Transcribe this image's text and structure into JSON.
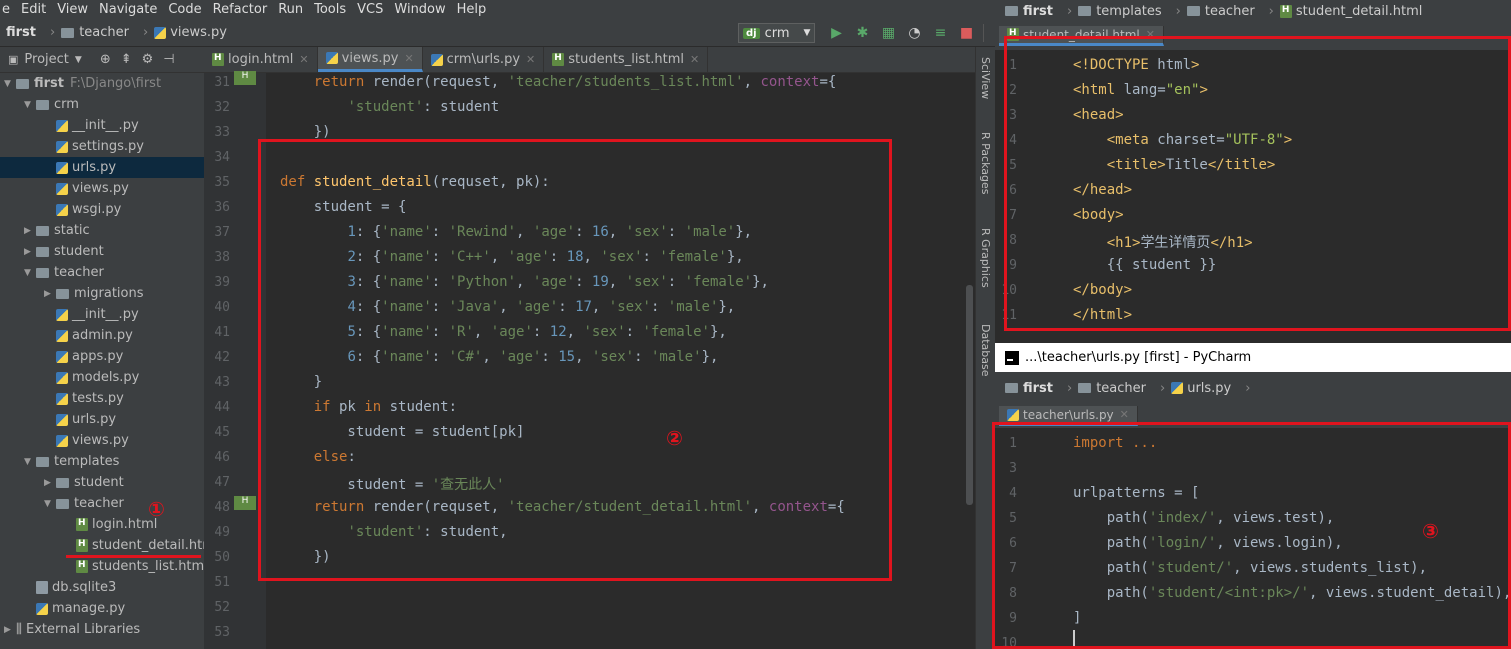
{
  "menu": [
    "e",
    "Edit",
    "View",
    "Navigate",
    "Code",
    "Refactor",
    "Run",
    "Tools",
    "VCS",
    "Window",
    "Help"
  ],
  "breadcrumb": {
    "project": "first",
    "folder": "teacher",
    "file": "views.py"
  },
  "run_config": {
    "badge": "dj",
    "name": "crm"
  },
  "project_panel": {
    "label": "Project"
  },
  "tree": [
    {
      "label": "first",
      "extra": "F:\\Django\\first",
      "type": "folder",
      "depth": 0,
      "open": true
    },
    {
      "label": "crm",
      "type": "folder",
      "depth": 1,
      "open": true
    },
    {
      "label": "__init__.py",
      "type": "py",
      "depth": 2
    },
    {
      "label": "settings.py",
      "type": "py",
      "depth": 2
    },
    {
      "label": "urls.py",
      "type": "py",
      "depth": 2,
      "selected": true
    },
    {
      "label": "views.py",
      "type": "py",
      "depth": 2
    },
    {
      "label": "wsgi.py",
      "type": "py",
      "depth": 2
    },
    {
      "label": "static",
      "type": "folder",
      "depth": 1,
      "open": false
    },
    {
      "label": "student",
      "type": "folder",
      "depth": 1,
      "open": false
    },
    {
      "label": "teacher",
      "type": "folder",
      "depth": 1,
      "open": true
    },
    {
      "label": "migrations",
      "type": "folder",
      "depth": 2,
      "open": false
    },
    {
      "label": "__init__.py",
      "type": "py",
      "depth": 2
    },
    {
      "label": "admin.py",
      "type": "py",
      "depth": 2
    },
    {
      "label": "apps.py",
      "type": "py",
      "depth": 2
    },
    {
      "label": "models.py",
      "type": "py",
      "depth": 2
    },
    {
      "label": "tests.py",
      "type": "py",
      "depth": 2
    },
    {
      "label": "urls.py",
      "type": "py",
      "depth": 2
    },
    {
      "label": "views.py",
      "type": "py",
      "depth": 2
    },
    {
      "label": "templates",
      "type": "folder",
      "depth": 1,
      "open": true
    },
    {
      "label": "student",
      "type": "folder",
      "depth": 2,
      "open": false
    },
    {
      "label": "teacher",
      "type": "folder",
      "depth": 2,
      "open": true
    },
    {
      "label": "login.html",
      "type": "html",
      "depth": 3
    },
    {
      "label": "student_detail.html",
      "type": "html",
      "depth": 3
    },
    {
      "label": "students_list.html",
      "type": "html",
      "depth": 3
    },
    {
      "label": "db.sqlite3",
      "type": "file",
      "depth": 1
    },
    {
      "label": "manage.py",
      "type": "py",
      "depth": 1
    },
    {
      "label": "External Libraries",
      "type": "lib",
      "depth": 0,
      "open": false
    }
  ],
  "tabs": [
    {
      "label": "login.html",
      "type": "html"
    },
    {
      "label": "views.py",
      "type": "py",
      "active": true
    },
    {
      "label": "crm\\urls.py",
      "type": "py"
    },
    {
      "label": "students_list.html",
      "type": "html"
    }
  ],
  "editor_lines": [
    {
      "n": "31",
      "t": [
        [
          "    ",
          ""
        ],
        [
          "return",
          "kw"
        ],
        [
          " render(request, ",
          ""
        ],
        [
          "'teacher/students_list.html'",
          "st"
        ],
        [
          ", ",
          ""
        ],
        [
          "context",
          "pm"
        ],
        [
          "={",
          ""
        ]
      ]
    },
    {
      "n": "32",
      "t": [
        [
          "        ",
          ""
        ],
        [
          "'student'",
          "st"
        ],
        [
          ": student",
          ""
        ]
      ]
    },
    {
      "n": "33",
      "t": [
        [
          "    })",
          ""
        ]
      ]
    },
    {
      "n": "34",
      "t": []
    },
    {
      "n": "35",
      "t": [
        [
          "def ",
          "kw"
        ],
        [
          "student_detail",
          "fn"
        ],
        [
          "(requset, pk):",
          ""
        ]
      ]
    },
    {
      "n": "36",
      "t": [
        [
          "    student = {",
          ""
        ]
      ]
    },
    {
      "n": "37",
      "t": [
        [
          "        ",
          ""
        ],
        [
          "1",
          "nm"
        ],
        [
          ": {",
          ""
        ],
        [
          "'name'",
          "st"
        ],
        [
          ": ",
          ""
        ],
        [
          "'Rewind'",
          "st"
        ],
        [
          ", ",
          ""
        ],
        [
          "'age'",
          "st"
        ],
        [
          ": ",
          ""
        ],
        [
          "16",
          "nm"
        ],
        [
          ", ",
          ""
        ],
        [
          "'sex'",
          "st"
        ],
        [
          ": ",
          ""
        ],
        [
          "'male'",
          "st"
        ],
        [
          "},",
          ""
        ]
      ]
    },
    {
      "n": "38",
      "t": [
        [
          "        ",
          ""
        ],
        [
          "2",
          "nm"
        ],
        [
          ": {",
          ""
        ],
        [
          "'name'",
          "st"
        ],
        [
          ": ",
          ""
        ],
        [
          "'C++'",
          "st"
        ],
        [
          ", ",
          ""
        ],
        [
          "'age'",
          "st"
        ],
        [
          ": ",
          ""
        ],
        [
          "18",
          "nm"
        ],
        [
          ", ",
          ""
        ],
        [
          "'sex'",
          "st"
        ],
        [
          ": ",
          ""
        ],
        [
          "'female'",
          "st"
        ],
        [
          "},",
          ""
        ]
      ]
    },
    {
      "n": "39",
      "t": [
        [
          "        ",
          ""
        ],
        [
          "3",
          "nm"
        ],
        [
          ": {",
          ""
        ],
        [
          "'name'",
          "st"
        ],
        [
          ": ",
          ""
        ],
        [
          "'Python'",
          "st"
        ],
        [
          ", ",
          ""
        ],
        [
          "'age'",
          "st"
        ],
        [
          ": ",
          ""
        ],
        [
          "19",
          "nm"
        ],
        [
          ", ",
          ""
        ],
        [
          "'sex'",
          "st"
        ],
        [
          ": ",
          ""
        ],
        [
          "'female'",
          "st"
        ],
        [
          "},",
          ""
        ]
      ]
    },
    {
      "n": "40",
      "t": [
        [
          "        ",
          ""
        ],
        [
          "4",
          "nm"
        ],
        [
          ": {",
          ""
        ],
        [
          "'name'",
          "st"
        ],
        [
          ": ",
          ""
        ],
        [
          "'Java'",
          "st"
        ],
        [
          ", ",
          ""
        ],
        [
          "'age'",
          "st"
        ],
        [
          ": ",
          ""
        ],
        [
          "17",
          "nm"
        ],
        [
          ", ",
          ""
        ],
        [
          "'sex'",
          "st"
        ],
        [
          ": ",
          ""
        ],
        [
          "'male'",
          "st"
        ],
        [
          "},",
          ""
        ]
      ]
    },
    {
      "n": "41",
      "t": [
        [
          "        ",
          ""
        ],
        [
          "5",
          "nm"
        ],
        [
          ": {",
          ""
        ],
        [
          "'name'",
          "st"
        ],
        [
          ": ",
          ""
        ],
        [
          "'R'",
          "st"
        ],
        [
          ", ",
          ""
        ],
        [
          "'age'",
          "st"
        ],
        [
          ": ",
          ""
        ],
        [
          "12",
          "nm"
        ],
        [
          ", ",
          ""
        ],
        [
          "'sex'",
          "st"
        ],
        [
          ": ",
          ""
        ],
        [
          "'female'",
          "st"
        ],
        [
          "},",
          ""
        ]
      ]
    },
    {
      "n": "42",
      "t": [
        [
          "        ",
          ""
        ],
        [
          "6",
          "nm"
        ],
        [
          ": {",
          ""
        ],
        [
          "'name'",
          "st"
        ],
        [
          ": ",
          ""
        ],
        [
          "'C#'",
          "st"
        ],
        [
          ", ",
          ""
        ],
        [
          "'age'",
          "st"
        ],
        [
          ": ",
          ""
        ],
        [
          "15",
          "nm"
        ],
        [
          ", ",
          ""
        ],
        [
          "'sex'",
          "st"
        ],
        [
          ": ",
          ""
        ],
        [
          "'male'",
          "st"
        ],
        [
          "},",
          ""
        ]
      ]
    },
    {
      "n": "43",
      "t": [
        [
          "    }",
          ""
        ]
      ]
    },
    {
      "n": "44",
      "t": [
        [
          "    ",
          ""
        ],
        [
          "if",
          "kw"
        ],
        [
          " pk ",
          ""
        ],
        [
          "in",
          "kw"
        ],
        [
          " student:",
          ""
        ]
      ]
    },
    {
      "n": "45",
      "t": [
        [
          "        student = student[pk]",
          ""
        ]
      ]
    },
    {
      "n": "46",
      "t": [
        [
          "    ",
          ""
        ],
        [
          "else",
          "kw"
        ],
        [
          ":",
          ""
        ]
      ]
    },
    {
      "n": "47",
      "t": [
        [
          "        student = ",
          ""
        ],
        [
          "'查无此人'",
          "st"
        ]
      ]
    },
    {
      "n": "48",
      "t": [
        [
          "    ",
          ""
        ],
        [
          "return",
          "kw"
        ],
        [
          " render(requset, ",
          ""
        ],
        [
          "'teacher/student_detail.html'",
          "st"
        ],
        [
          ", ",
          ""
        ],
        [
          "context",
          "pm"
        ],
        [
          "={",
          ""
        ]
      ]
    },
    {
      "n": "49",
      "t": [
        [
          "        ",
          ""
        ],
        [
          "'student'",
          "st"
        ],
        [
          ": student,",
          ""
        ]
      ]
    },
    {
      "n": "50",
      "t": [
        [
          "    })",
          ""
        ]
      ]
    },
    {
      "n": "51",
      "t": []
    },
    {
      "n": "52",
      "t": []
    },
    {
      "n": "53",
      "t": []
    }
  ],
  "side_tools": [
    "SciView",
    "R Packages",
    "R Graphics",
    "Database"
  ],
  "annotations": [
    "①",
    "②",
    "③"
  ],
  "right_top": {
    "breadcrumb": {
      "project": "first",
      "folder": "templates",
      "folder2": "teacher",
      "file": "student_detail.html"
    },
    "tab": "student_detail.html",
    "lines": [
      {
        "n": "1",
        "t": [
          [
            "<!DOCTYPE ",
            "tg"
          ],
          [
            "html",
            ""
          ],
          [
            ">",
            "tg"
          ]
        ]
      },
      {
        "n": "2",
        "t": [
          [
            "<html ",
            "tg"
          ],
          [
            "lang=",
            ""
          ],
          [
            "\"en\"",
            "av"
          ],
          [
            ">",
            "tg"
          ]
        ]
      },
      {
        "n": "3",
        "t": [
          [
            "<head>",
            "tg"
          ]
        ]
      },
      {
        "n": "4",
        "t": [
          [
            "    <meta ",
            "tg"
          ],
          [
            "charset=",
            ""
          ],
          [
            "\"UTF-8\"",
            "av"
          ],
          [
            ">",
            "tg"
          ]
        ]
      },
      {
        "n": "5",
        "t": [
          [
            "    <title>",
            "tg"
          ],
          [
            "Title",
            ""
          ],
          [
            "</title>",
            "tg"
          ]
        ]
      },
      {
        "n": "6",
        "t": [
          [
            "</head>",
            "tg"
          ]
        ]
      },
      {
        "n": "7",
        "t": [
          [
            "<body>",
            "tg"
          ]
        ]
      },
      {
        "n": "8",
        "t": [
          [
            "    <h1>",
            "tg"
          ],
          [
            "学生详情页",
            ""
          ],
          [
            "</h1>",
            "tg"
          ]
        ]
      },
      {
        "n": "9",
        "t": [
          [
            "    {{ student }}",
            ""
          ]
        ]
      },
      {
        "n": "10",
        "t": [
          [
            "</body>",
            "tg"
          ]
        ]
      },
      {
        "n": "11",
        "t": [
          [
            "</html>",
            "tg"
          ]
        ]
      }
    ]
  },
  "pycharm_title": "...\\teacher\\urls.py [first] - PyCharm",
  "right_bottom": {
    "breadcrumb": {
      "project": "first",
      "folder": "teacher",
      "file": "urls.py"
    },
    "tab": "teacher\\urls.py",
    "lines": [
      {
        "n": "1",
        "t": [
          [
            "import ...",
            "kw"
          ]
        ]
      },
      {
        "n": "3",
        "t": []
      },
      {
        "n": "4",
        "t": [
          [
            "urlpatterns = [",
            ""
          ]
        ]
      },
      {
        "n": "5",
        "t": [
          [
            "    path(",
            ""
          ],
          [
            "'index/'",
            "st"
          ],
          [
            ", views.test),",
            ""
          ]
        ]
      },
      {
        "n": "6",
        "t": [
          [
            "    path(",
            ""
          ],
          [
            "'login/'",
            "st"
          ],
          [
            ", views.login),",
            ""
          ]
        ]
      },
      {
        "n": "7",
        "t": [
          [
            "    path(",
            ""
          ],
          [
            "'student/'",
            "st"
          ],
          [
            ", views.students_list),",
            ""
          ]
        ]
      },
      {
        "n": "8",
        "t": [
          [
            "    path(",
            ""
          ],
          [
            "'student/<int:pk>/'",
            "st"
          ],
          [
            ", views.student_detail),",
            ""
          ]
        ]
      },
      {
        "n": "9",
        "t": [
          [
            "]",
            ""
          ]
        ]
      },
      {
        "n": "10",
        "t": []
      }
    ]
  }
}
